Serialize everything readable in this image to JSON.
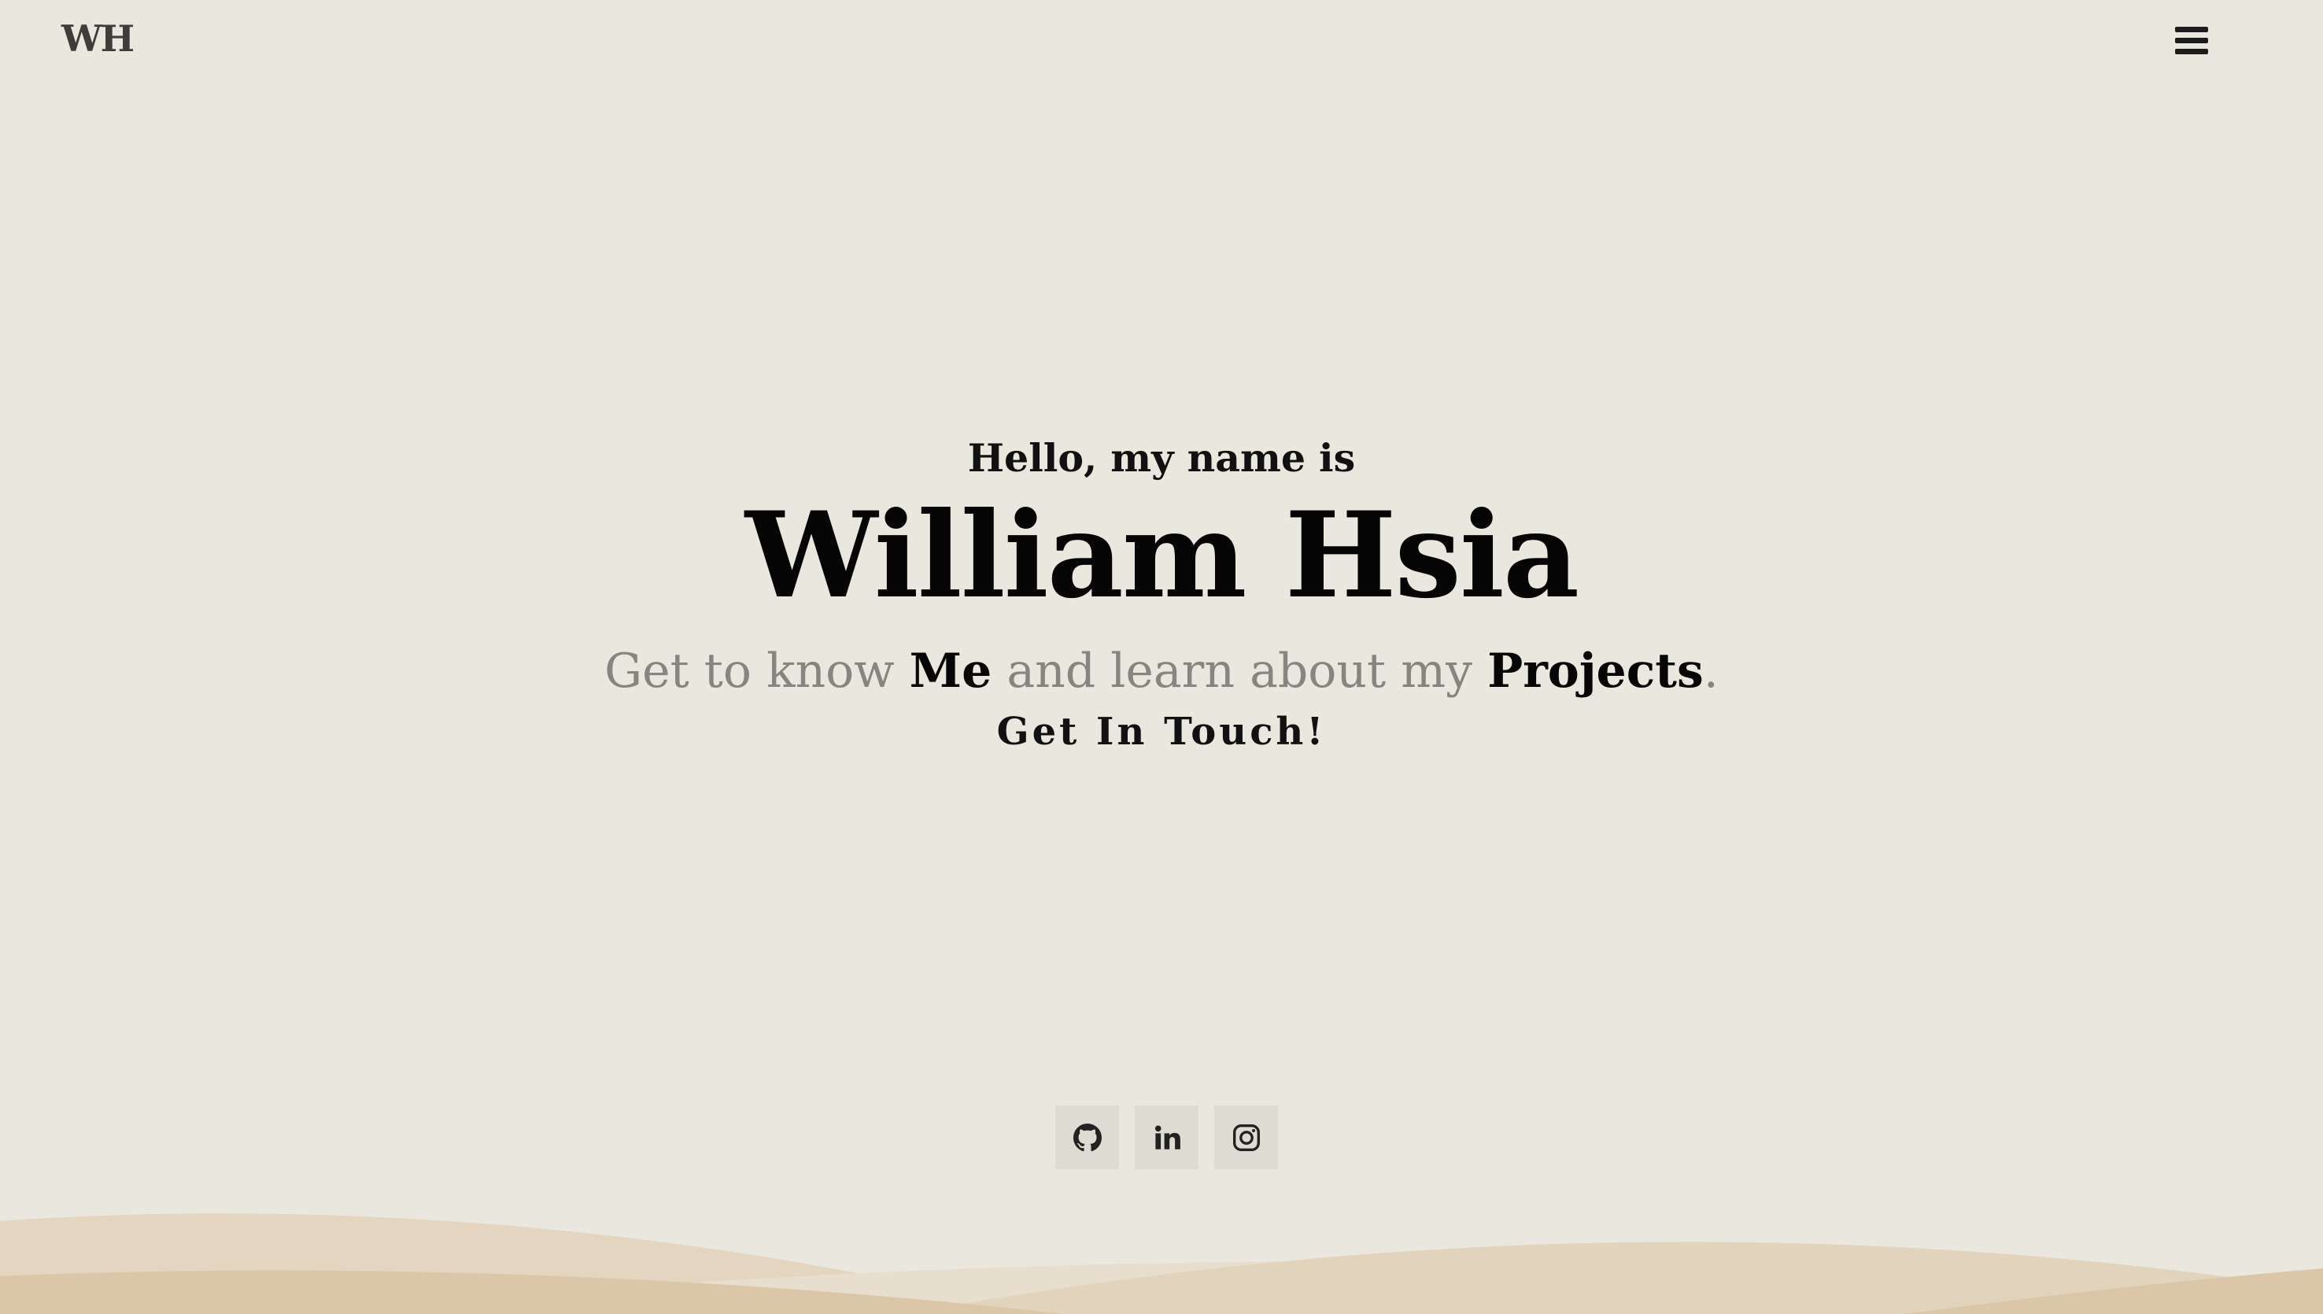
{
  "header": {
    "logo_text": "WH",
    "menu_icon": "hamburger-menu-icon"
  },
  "hero": {
    "greeting": "Hello, my name is",
    "name": "William Hsia",
    "tagline": {
      "part1": "Get to know ",
      "link_me": "Me",
      "part2": " and learn about my ",
      "link_projects": "Projects",
      "part3": "."
    },
    "contact_label": "Get In Touch!"
  },
  "socials": [
    {
      "icon": "github-icon"
    },
    {
      "icon": "linkedin-icon"
    },
    {
      "icon": "instagram-icon"
    }
  ],
  "colors": {
    "background": "#EAE8DE",
    "text_dark": "#0B0B0B",
    "text_muted": "#878580",
    "social_button_bg": "#DEDCD2",
    "wave_light": "#E5DCCB",
    "wave_mid": "#DFD0B8",
    "wave_dark": "#D9C3A4"
  }
}
